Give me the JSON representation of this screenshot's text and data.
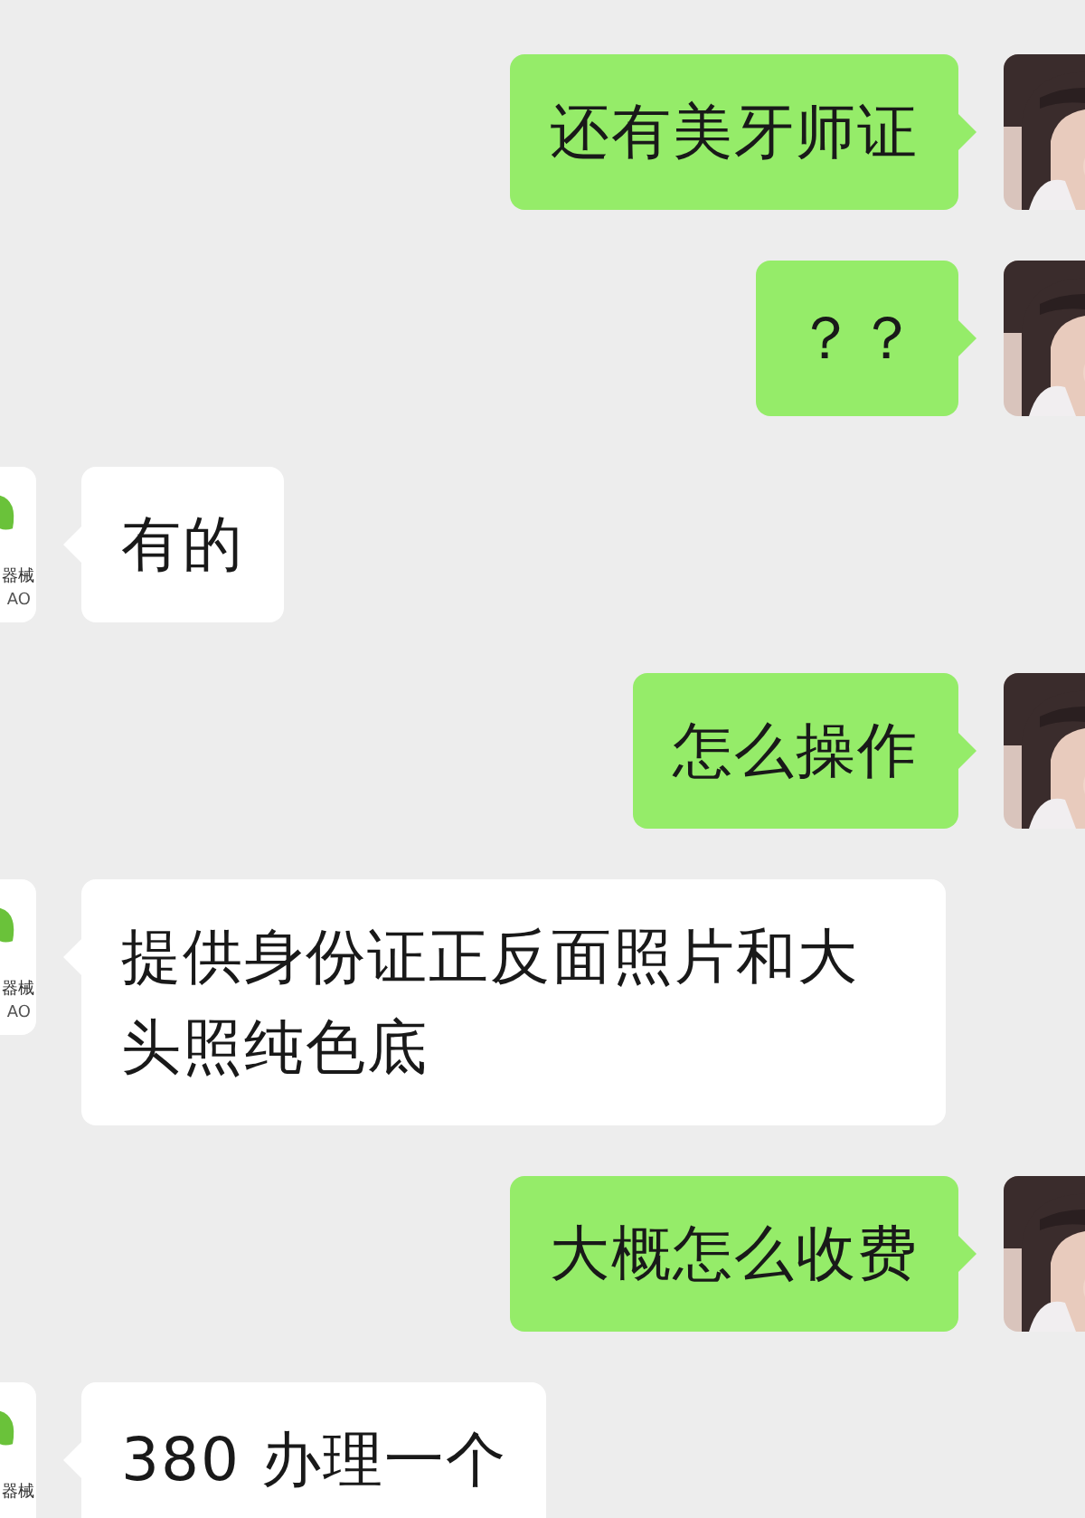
{
  "messages": [
    {
      "kind": "sent",
      "text": "还有美牙师证"
    },
    {
      "kind": "sent",
      "text": "？？"
    },
    {
      "kind": "received",
      "text": "有的",
      "avatar": {
        "line1": "器械",
        "line2": "AO"
      }
    },
    {
      "kind": "sent",
      "text": "怎么操作"
    },
    {
      "kind": "received",
      "text": "提供身份证正反面照片和大头照纯色底",
      "avatar": {
        "line1": "器械",
        "line2": "AO"
      }
    },
    {
      "kind": "sent",
      "text": "大概怎么收费"
    },
    {
      "kind": "received",
      "text": "380 办理一个",
      "avatar": {
        "line1": "器械"
      }
    }
  ]
}
